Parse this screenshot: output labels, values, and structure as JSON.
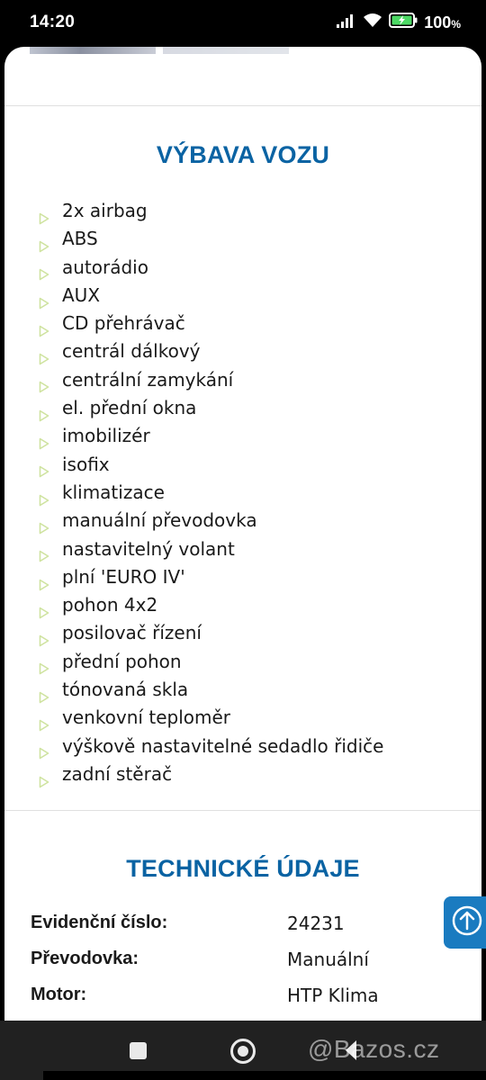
{
  "status_bar": {
    "time": "14:20",
    "battery": "100",
    "battery_unit": "%",
    "icons": [
      "signal-icon",
      "wifi-icon",
      "battery-charging-icon"
    ]
  },
  "equipment": {
    "title": "VÝBAVA VOZU",
    "items": [
      "2x airbag",
      "ABS",
      "autorádio",
      "AUX",
      "CD přehrávač",
      "centrál dálkový",
      "centrální zamykání",
      "el. přední okna",
      "imobilizér",
      "isofix",
      "klimatizace",
      "manuální převodovka",
      "nastavitelný volant",
      "plní 'EURO IV'",
      "pohon 4x2",
      "posilovač řízení",
      "přední pohon",
      "tónovaná skla",
      "venkovní teploměr",
      "výškově nastavitelné sedadlo řidiče",
      "zadní stěrač"
    ],
    "bullet_color": "#cfe3a0"
  },
  "technical": {
    "title": "TECHNICKÉ ÚDAJE",
    "rows": [
      {
        "label": "Evidenční číslo:",
        "value": "24231"
      },
      {
        "label": "Převodovka:",
        "value": "Manuální"
      },
      {
        "label": "Motor:",
        "value": "HTP Klima"
      }
    ]
  },
  "watermark": "@Bazos.cz",
  "colors": {
    "heading": "#0a63a3",
    "scroll_button": "#1a7bc0"
  }
}
